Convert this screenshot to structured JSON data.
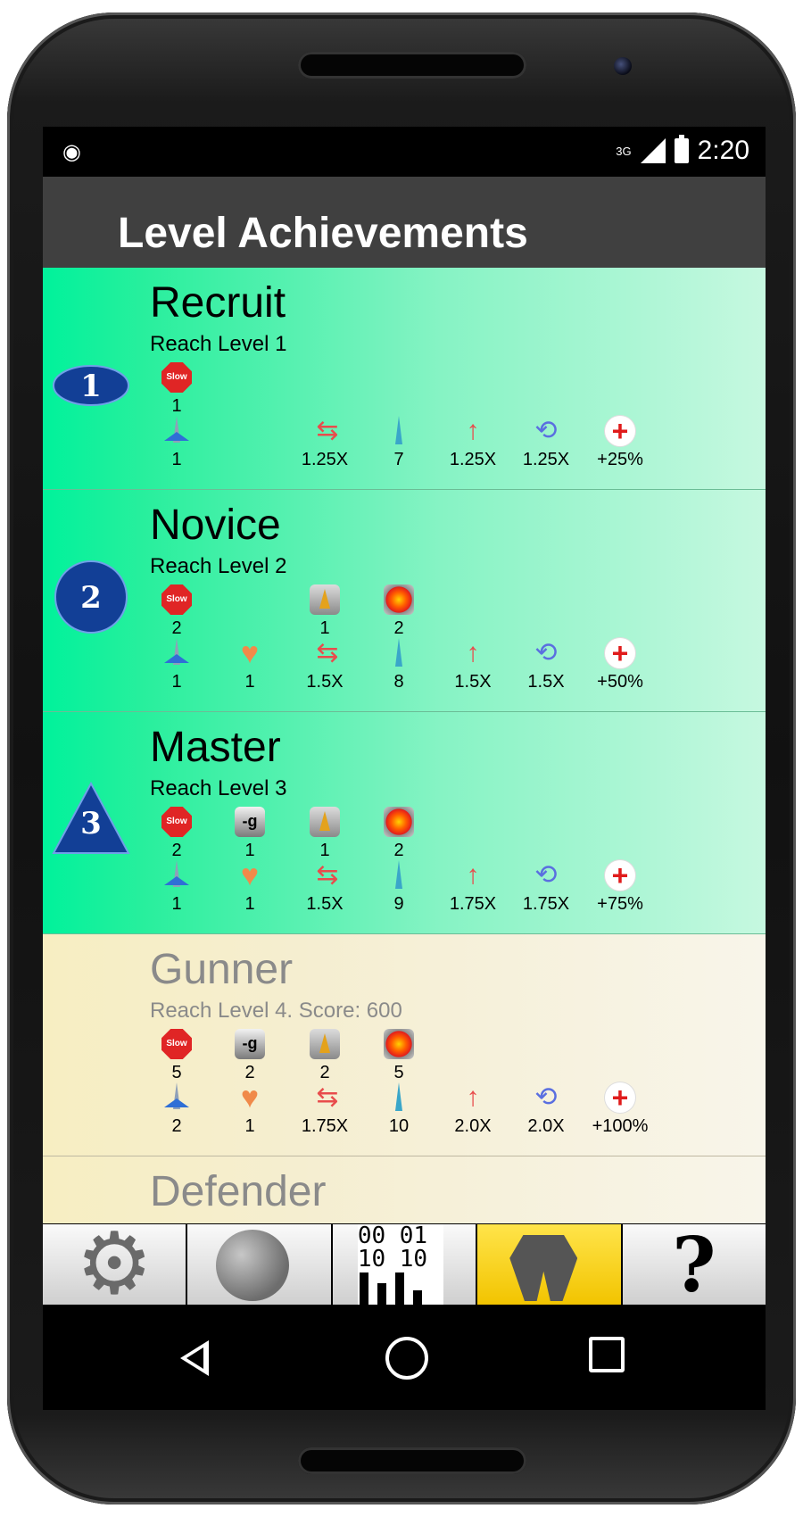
{
  "status": {
    "network": "3G",
    "time": "2:20"
  },
  "appbar": {
    "title": "Level Achievements"
  },
  "levels": [
    {
      "badge": "1",
      "badge_shape": "ellipse",
      "title": "Recruit",
      "desc": "Reach Level 1",
      "locked": false,
      "row1": [
        {
          "icon": "slow-icon",
          "label": "Slow",
          "value": "1"
        }
      ],
      "row2": [
        {
          "icon": "ship-icon",
          "value": "1"
        },
        {
          "icon": "speed-arrows-icon",
          "value": "1.25X"
        },
        {
          "icon": "rocket-icon",
          "value": "7"
        },
        {
          "icon": "rocket-speed-icon",
          "value": "1.25X"
        },
        {
          "icon": "reload-clock-icon",
          "value": "1.25X"
        },
        {
          "icon": "health-plus-icon",
          "value": "+25%"
        }
      ]
    },
    {
      "badge": "2",
      "badge_shape": "circle",
      "title": "Novice",
      "desc": "Reach Level 2",
      "locked": false,
      "row1": [
        {
          "icon": "slow-icon",
          "label": "Slow",
          "value": "2"
        },
        {
          "icon": "launcher-icon",
          "value": "1"
        },
        {
          "icon": "bomb-icon",
          "value": "2"
        }
      ],
      "row2": [
        {
          "icon": "ship-icon",
          "value": "1"
        },
        {
          "icon": "heart-icon",
          "value": "1"
        },
        {
          "icon": "speed-arrows-icon",
          "value": "1.5X"
        },
        {
          "icon": "rocket-icon",
          "value": "8"
        },
        {
          "icon": "rocket-speed-icon",
          "value": "1.5X"
        },
        {
          "icon": "reload-clock-icon",
          "value": "1.5X"
        },
        {
          "icon": "health-plus-icon",
          "value": "+50%"
        }
      ]
    },
    {
      "badge": "3",
      "badge_shape": "triangle",
      "title": "Master",
      "desc": "Reach Level 3",
      "locked": false,
      "row1": [
        {
          "icon": "slow-icon",
          "label": "Slow",
          "value": "2"
        },
        {
          "icon": "gravity-icon",
          "label": "-g",
          "value": "1"
        },
        {
          "icon": "launcher-icon",
          "value": "1"
        },
        {
          "icon": "bomb-icon",
          "value": "2"
        }
      ],
      "row2": [
        {
          "icon": "ship-icon",
          "value": "1"
        },
        {
          "icon": "heart-icon",
          "value": "1"
        },
        {
          "icon": "speed-arrows-icon",
          "value": "1.5X"
        },
        {
          "icon": "rocket-icon",
          "value": "9"
        },
        {
          "icon": "rocket-speed-icon",
          "value": "1.75X"
        },
        {
          "icon": "reload-clock-icon",
          "value": "1.75X"
        },
        {
          "icon": "health-plus-icon",
          "value": "+75%"
        }
      ]
    },
    {
      "badge": "",
      "badge_shape": "none",
      "title": "Gunner",
      "desc": "Reach Level 4. Score: 600",
      "locked": true,
      "row1": [
        {
          "icon": "slow-icon",
          "label": "Slow",
          "value": "5"
        },
        {
          "icon": "gravity-icon",
          "label": "-g",
          "value": "2"
        },
        {
          "icon": "launcher-icon",
          "value": "2"
        },
        {
          "icon": "bomb-icon",
          "value": "5"
        }
      ],
      "row2": [
        {
          "icon": "ship-icon",
          "value": "2"
        },
        {
          "icon": "heart-icon",
          "value": "1"
        },
        {
          "icon": "speed-arrows-icon",
          "value": "1.75X"
        },
        {
          "icon": "rocket-icon",
          "value": "10"
        },
        {
          "icon": "rocket-speed-icon",
          "value": "2.0X"
        },
        {
          "icon": "reload-clock-icon",
          "value": "2.0X"
        },
        {
          "icon": "health-plus-icon",
          "value": "+100%"
        }
      ]
    },
    {
      "badge": "",
      "badge_shape": "none",
      "title": "Defender",
      "desc": "",
      "locked": true,
      "row1": [],
      "row2": []
    }
  ],
  "tabs": [
    {
      "icon": "settings-gear-icon",
      "active": false
    },
    {
      "icon": "moon-ship-icon",
      "active": false
    },
    {
      "icon": "scores-binary-chart-icon",
      "active": false,
      "text_top": "00 01",
      "text_bottom": "10 10"
    },
    {
      "icon": "award-ribbon-icon",
      "active": true
    },
    {
      "icon": "help-question-icon",
      "active": false,
      "text": "?"
    }
  ],
  "colors": {
    "completed_start": "#00f29b",
    "completed_end": "#c6f8e0",
    "locked_start": "#f7eec2",
    "locked_end": "#f8f5ea",
    "active_tab": "#f2c400",
    "badge_blue": "#123f96"
  }
}
